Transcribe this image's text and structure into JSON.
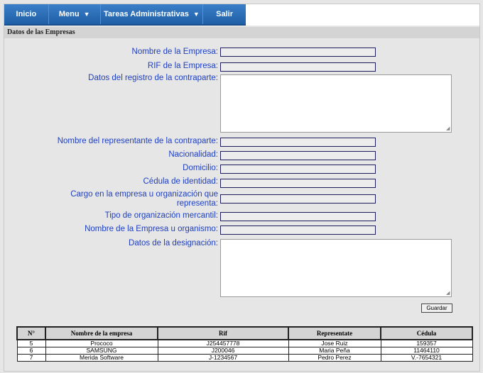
{
  "nav": {
    "items": [
      {
        "label": "Inicio",
        "has_caret": false
      },
      {
        "label": "Menu",
        "has_caret": true
      },
      {
        "label": "Tareas Administrativas",
        "has_caret": true
      },
      {
        "label": "Salir",
        "has_caret": false
      }
    ]
  },
  "section": {
    "title": "Datos de las Empresas"
  },
  "form": {
    "nombre_empresa": {
      "label": "Nombre de la Empresa:",
      "value": ""
    },
    "rif": {
      "label": "RIF de la Empresa:",
      "value": ""
    },
    "registro": {
      "label": "Datos del registro de la contraparte:",
      "value": ""
    },
    "representante": {
      "label": "Nombre del representante de la contraparte:",
      "value": ""
    },
    "nacionalidad": {
      "label": "Nacionalidad:",
      "value": ""
    },
    "domicilio": {
      "label": "Domicilio:",
      "value": ""
    },
    "cedula": {
      "label": "Cédula de identidad:",
      "value": ""
    },
    "cargo": {
      "label_line1": "Cargo en la empresa u organización que",
      "label_line2": "representa:",
      "value": ""
    },
    "tipo_org": {
      "label": "Tipo de organización mercantil:",
      "value": ""
    },
    "nombre_org": {
      "label": "Nombre de la Empresa u organismo:",
      "value": ""
    },
    "designacion": {
      "label": "Datos de la designación:",
      "value": ""
    },
    "save_label": "Guardar"
  },
  "table": {
    "headers": [
      "N°",
      "Nombre de la empresa",
      "Rif",
      "Representate",
      "Cédula"
    ],
    "rows": [
      [
        "5",
        "Prococo",
        "J254457778",
        "Jose Ruiz",
        "159357"
      ],
      [
        "6",
        "SAMSUNG",
        "J200046",
        "Maria Peña",
        "11464110"
      ],
      [
        "7",
        "Merida Software",
        "J-1234567",
        "Pedro Perez",
        "V.-7654321"
      ]
    ]
  }
}
